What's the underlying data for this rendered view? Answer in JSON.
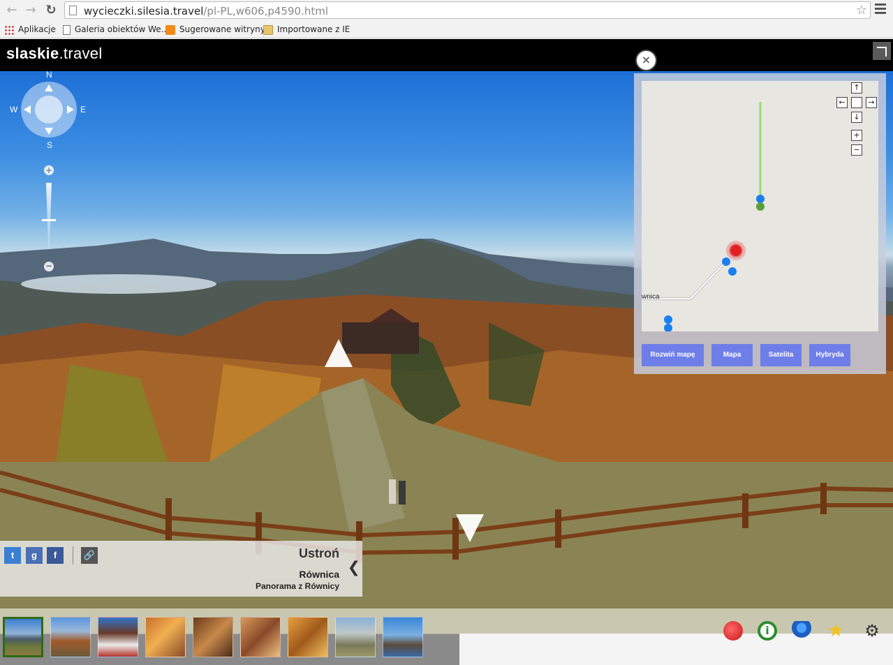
{
  "browser": {
    "url_host": "wycieczki.silesia.travel",
    "url_path": "/pl-PL,w606,p4590.html",
    "bookmarks": [
      {
        "label": "Aplikacje",
        "icon": "apps-grid-icon"
      },
      {
        "label": "Galeria obiektów We...",
        "icon": "page-icon"
      },
      {
        "label": "Sugerowane witryny",
        "icon": "bulb-icon"
      },
      {
        "label": "Importowane z IE",
        "icon": "folder-icon"
      }
    ]
  },
  "site": {
    "logo_bold": "slaskie",
    "logo_rest": ".travel"
  },
  "compass": {
    "n": "N",
    "s": "S",
    "w": "W",
    "e": "E",
    "zoom_in": "+",
    "zoom_out": "−"
  },
  "map": {
    "close": "×",
    "place_label": "wnica",
    "buttons": [
      "Rozwiń mapę",
      "Mapa",
      "Satelita",
      "Hybryda"
    ],
    "controls": {
      "up": "↑",
      "down": "↓",
      "left": "←",
      "right": "→",
      "zoom_in": "+",
      "zoom_out": "−"
    }
  },
  "info": {
    "town": "Ustroń",
    "place": "Równica",
    "subtitle": "Panorama z Równicy",
    "collapse": "❮",
    "share": {
      "twitter": "t",
      "google": "g",
      "facebook": "f",
      "link": "🔗"
    }
  },
  "thumbnails": [
    {
      "name": "thumb-1",
      "active": true
    },
    {
      "name": "thumb-2"
    },
    {
      "name": "thumb-3"
    },
    {
      "name": "thumb-4"
    },
    {
      "name": "thumb-5"
    },
    {
      "name": "thumb-6"
    },
    {
      "name": "thumb-7"
    },
    {
      "name": "thumb-8"
    },
    {
      "name": "thumb-9"
    }
  ],
  "tools": {
    "gear": "⚙",
    "star": "★",
    "info": "i"
  },
  "colors": {
    "map_button": "#6e7ee8",
    "marker_blue": "#1a7ff0",
    "marker_red": "#e02020",
    "route_green": "#8fe06a"
  }
}
